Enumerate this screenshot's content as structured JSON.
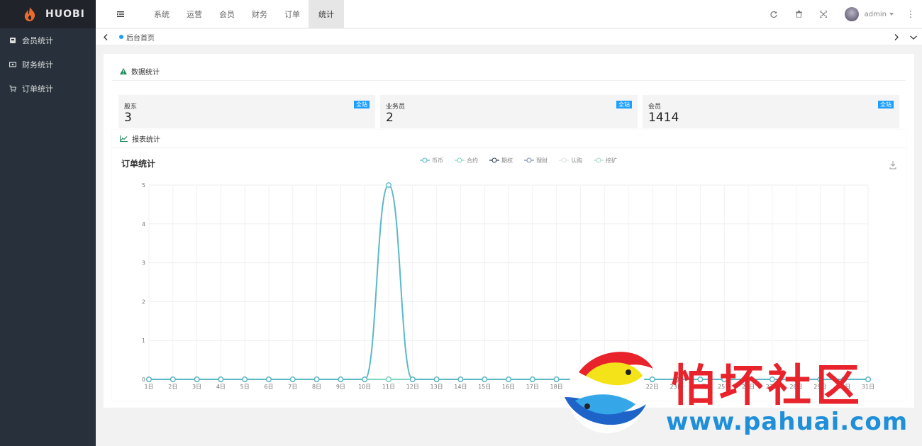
{
  "app": {
    "brand": "HUOBI"
  },
  "sidebar": {
    "items": [
      {
        "label": "会员统计",
        "icon": "member-card-icon"
      },
      {
        "label": "财务统计",
        "icon": "cash-icon"
      },
      {
        "label": "订单统计",
        "icon": "cart-icon"
      }
    ]
  },
  "topnav": {
    "tabs": [
      "系统",
      "运营",
      "会员",
      "财务",
      "订单",
      "统计"
    ],
    "active": "统计",
    "user": "admin"
  },
  "tabstrip": {
    "current": "后台首页"
  },
  "stats": {
    "title": "数据统计",
    "boxes": [
      {
        "label": "股东",
        "value": "3",
        "badge": "全站"
      },
      {
        "label": "业务员",
        "value": "2",
        "badge": "全站"
      },
      {
        "label": "会员",
        "value": "1414",
        "badge": "全站"
      }
    ]
  },
  "report": {
    "title": "报表统计"
  },
  "chart_data": {
    "type": "line",
    "title": "订单统计",
    "categories": [
      "1日",
      "2日",
      "3日",
      "4日",
      "5日",
      "6日",
      "7日",
      "8日",
      "9日",
      "10日",
      "11日",
      "12日",
      "13日",
      "14日",
      "15日",
      "16日",
      "17日",
      "18日",
      "19日",
      "20日",
      "21日",
      "22日",
      "23日",
      "24日",
      "25日",
      "26日",
      "27日",
      "28日",
      "29日",
      "30日",
      "31日"
    ],
    "ylim": [
      0,
      5
    ],
    "yticks": [
      0,
      1,
      2,
      3,
      4,
      5
    ],
    "series": [
      {
        "name": "币币",
        "color": "#5bb8c8",
        "values": [
          0,
          0,
          0,
          0,
          0,
          0,
          0,
          0,
          0,
          0,
          5,
          0,
          0,
          0,
          0,
          0,
          0,
          0,
          0,
          0,
          0,
          0,
          0,
          0,
          0,
          0,
          0,
          0,
          0,
          0,
          0
        ]
      },
      {
        "name": "合约",
        "color": "#7fd6c2",
        "values": [
          0,
          0,
          0,
          0,
          0,
          0,
          0,
          0,
          0,
          0,
          0,
          0,
          0,
          0,
          0,
          0,
          0,
          0,
          0,
          0,
          0,
          0,
          0,
          0,
          0,
          0,
          0,
          0,
          0,
          0,
          0
        ]
      },
      {
        "name": "期权",
        "color": "#2f3e4f",
        "values": [
          0,
          0,
          0,
          0,
          0,
          0,
          0,
          0,
          0,
          0,
          0,
          0,
          0,
          0,
          0,
          0,
          0,
          0,
          0,
          0,
          0,
          0,
          0,
          0,
          0,
          0,
          0,
          0,
          0,
          0,
          0
        ]
      },
      {
        "name": "理财",
        "color": "#7a8fb0",
        "values": [
          0,
          0,
          0,
          0,
          0,
          0,
          0,
          0,
          0,
          0,
          0,
          0,
          0,
          0,
          0,
          0,
          0,
          0,
          0,
          0,
          0,
          0,
          0,
          0,
          0,
          0,
          0,
          0,
          0,
          0,
          0
        ]
      },
      {
        "name": "认购",
        "color": "#d8e3e6",
        "values": [
          0,
          0,
          0,
          0,
          0,
          0,
          0,
          0,
          0,
          0,
          0,
          0,
          0,
          0,
          0,
          0,
          0,
          0,
          0,
          0,
          0,
          0,
          0,
          0,
          0,
          0,
          0,
          0,
          0,
          0,
          0
        ]
      },
      {
        "name": "挖矿",
        "color": "#a9d9cf",
        "values": [
          0,
          0,
          0,
          0,
          0,
          0,
          0,
          0,
          0,
          0,
          0,
          0,
          0,
          0,
          0,
          0,
          0,
          0,
          0,
          0,
          0,
          0,
          0,
          0,
          0,
          0,
          0,
          0,
          0,
          0,
          0
        ]
      }
    ],
    "grid": true,
    "legend": "top-center"
  },
  "watermark": {
    "text": "怕坏社区",
    "url": "www.pahuai.com"
  }
}
